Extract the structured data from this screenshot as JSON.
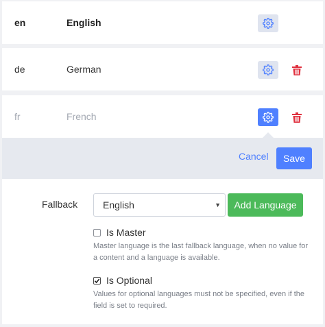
{
  "languages": [
    {
      "code": "en",
      "name": "English"
    },
    {
      "code": "de",
      "name": "German"
    },
    {
      "code": "fr",
      "name": "French"
    }
  ],
  "edit_panel": {
    "cancel_label": "Cancel",
    "save_label": "Save",
    "fallback_label": "Fallback",
    "fallback_selected": "English",
    "add_language_label": "Add Language",
    "is_master": {
      "label": "Is Master",
      "checked": false,
      "hint": "Master language is the last fallback language, when no value for a content and a language is available."
    },
    "is_optional": {
      "label": "Is Optional",
      "checked": true,
      "hint": "Values for optional languages must not be specified, even if the field is set to required."
    }
  },
  "colors": {
    "accent": "#4f80ff",
    "success": "#4cba5a",
    "danger": "#e0313f",
    "muted_text": "#a3a8b2"
  },
  "icons": {
    "settings": "gear-icon",
    "delete": "trash-icon",
    "dropdown": "chevron-down-icon",
    "check": "check-icon"
  }
}
